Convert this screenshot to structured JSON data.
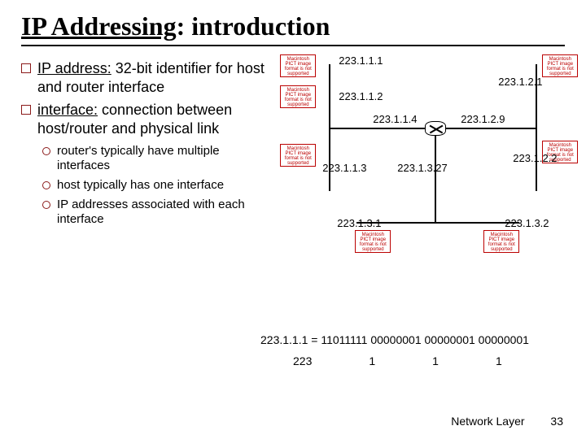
{
  "title": {
    "underlined": "IP Addressing",
    "rest": ": introduction"
  },
  "bullets": [
    {
      "term": "IP address:",
      "rest": " 32-bit identifier for host and router interface"
    },
    {
      "term": "interface:",
      "rest": " connection between host/router and physical link"
    }
  ],
  "subbullets": [
    "router's typically have multiple interfaces",
    "host typically has one interface",
    "IP addresses associated with each interface"
  ],
  "placeholder_text": "Macintosh PICT image format is not supported",
  "diagram": {
    "ips": {
      "a1": "223.1.1.1",
      "a2": "223.1.1.2",
      "a3": "223.1.1.3",
      "a4": "223.1.1.4",
      "b1": "223.1.2.1",
      "b2": "223.1.2.2",
      "b9": "223.1.2.9",
      "c27": "223.1.3.27",
      "c1": "223.1.3.1",
      "c2": "223.1.3.2"
    }
  },
  "equation": "223.1.1.1 = 11011111 00000001 00000001 00000001",
  "octets": [
    "223",
    "1",
    "1",
    "1"
  ],
  "footer": {
    "label": "Network Layer",
    "page": "33"
  }
}
